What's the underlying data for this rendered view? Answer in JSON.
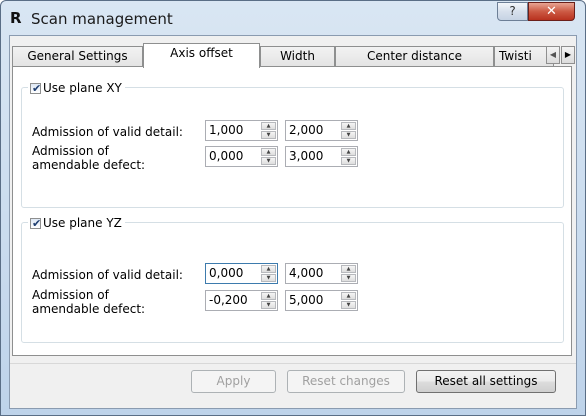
{
  "window": {
    "app_icon": "R",
    "title": "Scan management",
    "help_icon": "?",
    "close_icon": "✕"
  },
  "tabs": [
    {
      "label": "General Settings"
    },
    {
      "label": "Axis offset"
    },
    {
      "label": "Width"
    },
    {
      "label": "Center distance"
    },
    {
      "label": "Twisti"
    }
  ],
  "tab_scroll": {
    "left_icon": "◀",
    "right_icon": "▶"
  },
  "group_xy": {
    "checkbox_label": "Use plane XY",
    "checked": true,
    "row1": {
      "label": "Admission of valid detail:",
      "value1": "1,000",
      "value2": "2,000"
    },
    "row2": {
      "label_line1": "Admission of",
      "label_line2": "amendable defect:",
      "value1": "0,000",
      "value2": "3,000"
    }
  },
  "group_yz": {
    "checkbox_label": "Use plane YZ",
    "checked": true,
    "row1": {
      "label": "Admission of valid detail:",
      "value1": "0,000",
      "value2": "4,000"
    },
    "row2": {
      "label_line1": "Admission of",
      "label_line2": "amendable defect:",
      "value1": "-0,200",
      "value2": "5,000"
    }
  },
  "buttons": {
    "apply": "Apply",
    "reset_changes": "Reset changes",
    "reset_all": "Reset all settings"
  },
  "icons": {
    "checkmark": "✔",
    "spin_up": "▲",
    "spin_down": "▼"
  }
}
